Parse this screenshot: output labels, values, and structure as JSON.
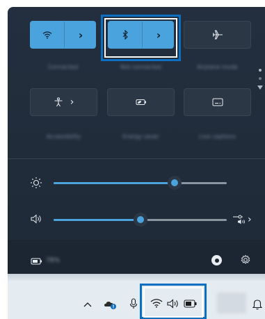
{
  "quick_settings": {
    "tiles_row1": [
      {
        "name": "wifi",
        "icon": "wifi-icon",
        "active": true,
        "has_arrow": true,
        "label": "Connected"
      },
      {
        "name": "bluetooth",
        "icon": "bluetooth-icon",
        "active": true,
        "has_arrow": true,
        "label": "Not connected"
      },
      {
        "name": "airplane",
        "icon": "airplane-icon",
        "active": false,
        "has_arrow": false,
        "label": "Airplane mode"
      }
    ],
    "tiles_row2": [
      {
        "name": "accessibility",
        "icon": "accessibility-icon",
        "active": false,
        "has_arrow": true,
        "label": "Accessibility"
      },
      {
        "name": "energy-saver",
        "icon": "energy-saver-icon",
        "active": false,
        "has_arrow": false,
        "label": "Energy saver"
      },
      {
        "name": "live-captions",
        "icon": "captions-icon",
        "active": false,
        "has_arrow": false,
        "label": "Live captions"
      }
    ],
    "brightness_level": 0.7,
    "volume_level": 0.5,
    "battery_label": "78%",
    "arrow_glyph": "›"
  },
  "taskbar": {
    "icons": [
      "chevron-up-icon",
      "onedrive-icon",
      "microphone-icon",
      "wifi-icon",
      "volume-icon",
      "battery-icon",
      "bell-icon"
    ]
  },
  "colors": {
    "accent": "#4aa3dd",
    "panel": "#232f3e",
    "highlight": "#0d6fc1"
  }
}
